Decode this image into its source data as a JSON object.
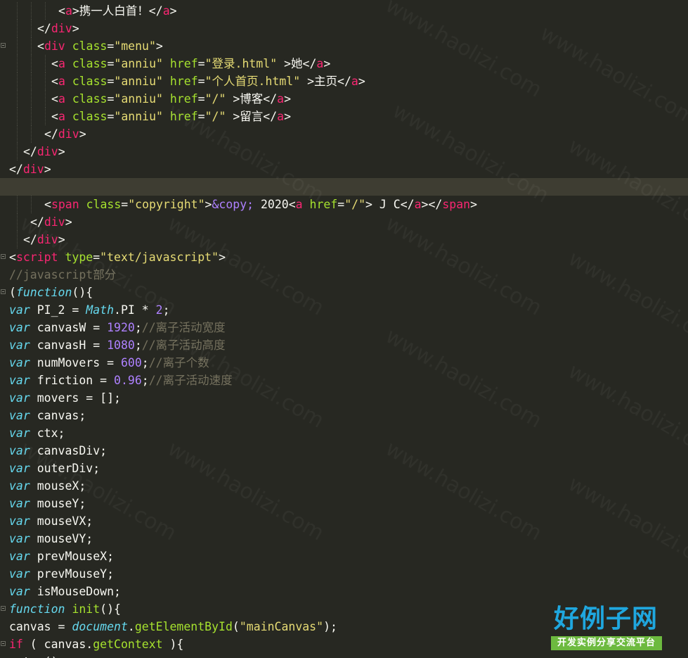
{
  "editor": {
    "theme_colors": {
      "background": "#272822",
      "current_line": "#3E3D32",
      "tag": "#F92672",
      "attribute": "#A6E22E",
      "string": "#E6DB74",
      "keyword": "#66D9EF",
      "number": "#AE81FF",
      "comment": "#75715E",
      "text": "#F8F8F2"
    },
    "lines": [
      {
        "indent": 8,
        "tokens": [
          [
            "plain",
            "<"
          ],
          [
            "tag",
            "a"
          ],
          [
            "plain",
            ">携一人白首！</"
          ],
          [
            "tag",
            "a"
          ],
          [
            "plain",
            ">"
          ]
        ]
      },
      {
        "indent": 5,
        "tokens": [
          [
            "plain",
            "</"
          ],
          [
            "tag",
            "div"
          ],
          [
            "plain",
            ">"
          ]
        ]
      },
      {
        "indent": 5,
        "fold": true,
        "tokens": [
          [
            "plain",
            "<"
          ],
          [
            "tag",
            "div"
          ],
          [
            "plain",
            " "
          ],
          [
            "attr",
            "class"
          ],
          [
            "plain",
            "="
          ],
          [
            "str",
            "\"menu\""
          ],
          [
            "plain",
            ">"
          ]
        ]
      },
      {
        "indent": 7,
        "tokens": [
          [
            "plain",
            "<"
          ],
          [
            "tag",
            "a"
          ],
          [
            "plain",
            " "
          ],
          [
            "attr",
            "class"
          ],
          [
            "plain",
            "="
          ],
          [
            "str",
            "\"anniu\""
          ],
          [
            "plain",
            " "
          ],
          [
            "attr",
            "href"
          ],
          [
            "plain",
            "="
          ],
          [
            "str",
            "\"登录.html\""
          ],
          [
            "plain",
            " >她</"
          ],
          [
            "tag",
            "a"
          ],
          [
            "plain",
            ">"
          ]
        ]
      },
      {
        "indent": 7,
        "tokens": [
          [
            "plain",
            "<"
          ],
          [
            "tag",
            "a"
          ],
          [
            "plain",
            " "
          ],
          [
            "attr",
            "class"
          ],
          [
            "plain",
            "="
          ],
          [
            "str",
            "\"anniu\""
          ],
          [
            "plain",
            " "
          ],
          [
            "attr",
            "href"
          ],
          [
            "plain",
            "="
          ],
          [
            "str",
            "\"个人首页.html\""
          ],
          [
            "plain",
            " >主页</"
          ],
          [
            "tag",
            "a"
          ],
          [
            "plain",
            ">"
          ]
        ]
      },
      {
        "indent": 7,
        "tokens": [
          [
            "plain",
            "<"
          ],
          [
            "tag",
            "a"
          ],
          [
            "plain",
            " "
          ],
          [
            "attr",
            "class"
          ],
          [
            "plain",
            "="
          ],
          [
            "str",
            "\"anniu\""
          ],
          [
            "plain",
            " "
          ],
          [
            "attr",
            "href"
          ],
          [
            "plain",
            "="
          ],
          [
            "str",
            "\"/\""
          ],
          [
            "plain",
            " >博客</"
          ],
          [
            "tag",
            "a"
          ],
          [
            "plain",
            ">"
          ]
        ]
      },
      {
        "indent": 7,
        "tokens": [
          [
            "plain",
            "<"
          ],
          [
            "tag",
            "a"
          ],
          [
            "plain",
            " "
          ],
          [
            "attr",
            "class"
          ],
          [
            "plain",
            "="
          ],
          [
            "str",
            "\"anniu\""
          ],
          [
            "plain",
            " "
          ],
          [
            "attr",
            "href"
          ],
          [
            "plain",
            "="
          ],
          [
            "str",
            "\"/\""
          ],
          [
            "plain",
            " >留言</"
          ],
          [
            "tag",
            "a"
          ],
          [
            "plain",
            ">"
          ]
        ]
      },
      {
        "indent": 6,
        "tokens": [
          [
            "plain",
            "</"
          ],
          [
            "tag",
            "div"
          ],
          [
            "plain",
            ">"
          ]
        ]
      },
      {
        "indent": 3,
        "tokens": [
          [
            "plain",
            "</"
          ],
          [
            "tag",
            "div"
          ],
          [
            "plain",
            ">"
          ]
        ]
      },
      {
        "indent": 1,
        "tokens": [
          [
            "plain",
            "</"
          ],
          [
            "tag",
            "div"
          ],
          [
            "plain",
            ">"
          ]
        ]
      },
      {
        "indent": 1,
        "current": true,
        "tokens": []
      },
      {
        "indent": 6,
        "tokens": [
          [
            "plain",
            "<"
          ],
          [
            "tag",
            "span"
          ],
          [
            "plain",
            " "
          ],
          [
            "attr",
            "class"
          ],
          [
            "plain",
            "="
          ],
          [
            "str",
            "\"copyright\""
          ],
          [
            "plain",
            ">"
          ],
          [
            "ent",
            "&copy;"
          ],
          [
            "plain",
            " 2020<"
          ],
          [
            "tag",
            "a"
          ],
          [
            "plain",
            " "
          ],
          [
            "attr",
            "href"
          ],
          [
            "plain",
            "="
          ],
          [
            "str",
            "\"/\""
          ],
          [
            "plain",
            "> J C</"
          ],
          [
            "tag",
            "a"
          ],
          [
            "plain",
            "></"
          ],
          [
            "tag",
            "span"
          ],
          [
            "plain",
            ">"
          ]
        ]
      },
      {
        "indent": 4,
        "tokens": [
          [
            "plain",
            "</"
          ],
          [
            "tag",
            "div"
          ],
          [
            "plain",
            ">"
          ]
        ]
      },
      {
        "indent": 3,
        "tokens": [
          [
            "plain",
            "</"
          ],
          [
            "tag",
            "div"
          ],
          [
            "plain",
            ">"
          ]
        ]
      },
      {
        "indent": 1,
        "fold": true,
        "tokens": [
          [
            "plain",
            "<"
          ],
          [
            "tag",
            "script"
          ],
          [
            "plain",
            " "
          ],
          [
            "attr",
            "type"
          ],
          [
            "plain",
            "="
          ],
          [
            "str",
            "\"text/javascript\""
          ],
          [
            "plain",
            ">"
          ]
        ]
      },
      {
        "indent": 1,
        "tokens": [
          [
            "com",
            "//javascript部分"
          ]
        ]
      },
      {
        "indent": 1,
        "fold": true,
        "tokens": [
          [
            "plain",
            "("
          ],
          [
            "kw",
            "function"
          ],
          [
            "plain",
            "(){"
          ]
        ]
      },
      {
        "indent": 1,
        "tokens": [
          [
            "kw",
            "var"
          ],
          [
            "plain",
            " PI_2 = "
          ],
          [
            "kw",
            "Math"
          ],
          [
            "plain",
            ".PI * "
          ],
          [
            "num",
            "2"
          ],
          [
            "plain",
            ";"
          ]
        ]
      },
      {
        "indent": 1,
        "tokens": [
          [
            "kw",
            "var"
          ],
          [
            "plain",
            " canvasW = "
          ],
          [
            "num",
            "1920"
          ],
          [
            "plain",
            ";"
          ],
          [
            "com",
            "//离子活动宽度"
          ]
        ]
      },
      {
        "indent": 1,
        "tokens": [
          [
            "kw",
            "var"
          ],
          [
            "plain",
            " canvasH = "
          ],
          [
            "num",
            "1080"
          ],
          [
            "plain",
            ";"
          ],
          [
            "com",
            "//离子活动高度"
          ]
        ]
      },
      {
        "indent": 1,
        "tokens": [
          [
            "kw",
            "var"
          ],
          [
            "plain",
            " numMovers = "
          ],
          [
            "num",
            "600"
          ],
          [
            "plain",
            ";"
          ],
          [
            "com",
            "//离子个数"
          ]
        ]
      },
      {
        "indent": 1,
        "tokens": [
          [
            "kw",
            "var"
          ],
          [
            "plain",
            " friction = "
          ],
          [
            "num",
            "0.96"
          ],
          [
            "plain",
            ";"
          ],
          [
            "com",
            "//离子活动速度"
          ]
        ]
      },
      {
        "indent": 1,
        "tokens": [
          [
            "kw",
            "var"
          ],
          [
            "plain",
            " movers = [];"
          ]
        ]
      },
      {
        "indent": 1,
        "tokens": [
          [
            "kw",
            "var"
          ],
          [
            "plain",
            " canvas;"
          ]
        ]
      },
      {
        "indent": 1,
        "tokens": [
          [
            "kw",
            "var"
          ],
          [
            "plain",
            " ctx;"
          ]
        ]
      },
      {
        "indent": 1,
        "tokens": [
          [
            "kw",
            "var"
          ],
          [
            "plain",
            " canvasDiv;"
          ]
        ]
      },
      {
        "indent": 1,
        "tokens": [
          [
            "kw",
            "var"
          ],
          [
            "plain",
            " outerDiv;"
          ]
        ]
      },
      {
        "indent": 1,
        "tokens": [
          [
            "kw",
            "var"
          ],
          [
            "plain",
            " mouseX;"
          ]
        ]
      },
      {
        "indent": 1,
        "tokens": [
          [
            "kw",
            "var"
          ],
          [
            "plain",
            " mouseY;"
          ]
        ]
      },
      {
        "indent": 1,
        "tokens": [
          [
            "kw",
            "var"
          ],
          [
            "plain",
            " mouseVX;"
          ]
        ]
      },
      {
        "indent": 1,
        "tokens": [
          [
            "kw",
            "var"
          ],
          [
            "plain",
            " mouseVY;"
          ]
        ]
      },
      {
        "indent": 1,
        "tokens": [
          [
            "kw",
            "var"
          ],
          [
            "plain",
            " prevMouseX;"
          ]
        ]
      },
      {
        "indent": 1,
        "tokens": [
          [
            "kw",
            "var"
          ],
          [
            "plain",
            " prevMouseY;"
          ]
        ]
      },
      {
        "indent": 1,
        "tokens": [
          [
            "kw",
            "var"
          ],
          [
            "plain",
            " isMouseDown;"
          ]
        ]
      },
      {
        "indent": 1,
        "fold": true,
        "tokens": [
          [
            "kw",
            "function"
          ],
          [
            "plain",
            " "
          ],
          [
            "fn",
            "init"
          ],
          [
            "plain",
            "(){"
          ]
        ]
      },
      {
        "indent": 1,
        "tokens": [
          [
            "plain",
            "canvas = "
          ],
          [
            "kw",
            "document"
          ],
          [
            "plain",
            "."
          ],
          [
            "fn",
            "getElementById"
          ],
          [
            "plain",
            "("
          ],
          [
            "str",
            "\"mainCanvas\""
          ],
          [
            "plain",
            ");"
          ]
        ]
      },
      {
        "indent": 1,
        "fold": true,
        "tokens": [
          [
            "tag",
            "if"
          ],
          [
            "plain",
            " ( canvas."
          ],
          [
            "fn",
            "getContext"
          ],
          [
            "plain",
            " ){"
          ]
        ]
      },
      {
        "indent": 1,
        "tokens": [
          [
            "plain",
            "setup();"
          ]
        ]
      }
    ]
  },
  "watermark": {
    "text": "www.haolizi.com"
  },
  "logo": {
    "title": "好例子网",
    "subtitle": "开发实例分享交流平台",
    "title_color": "#1FA7DF",
    "subtitle_bg": "#6DBA3F"
  }
}
